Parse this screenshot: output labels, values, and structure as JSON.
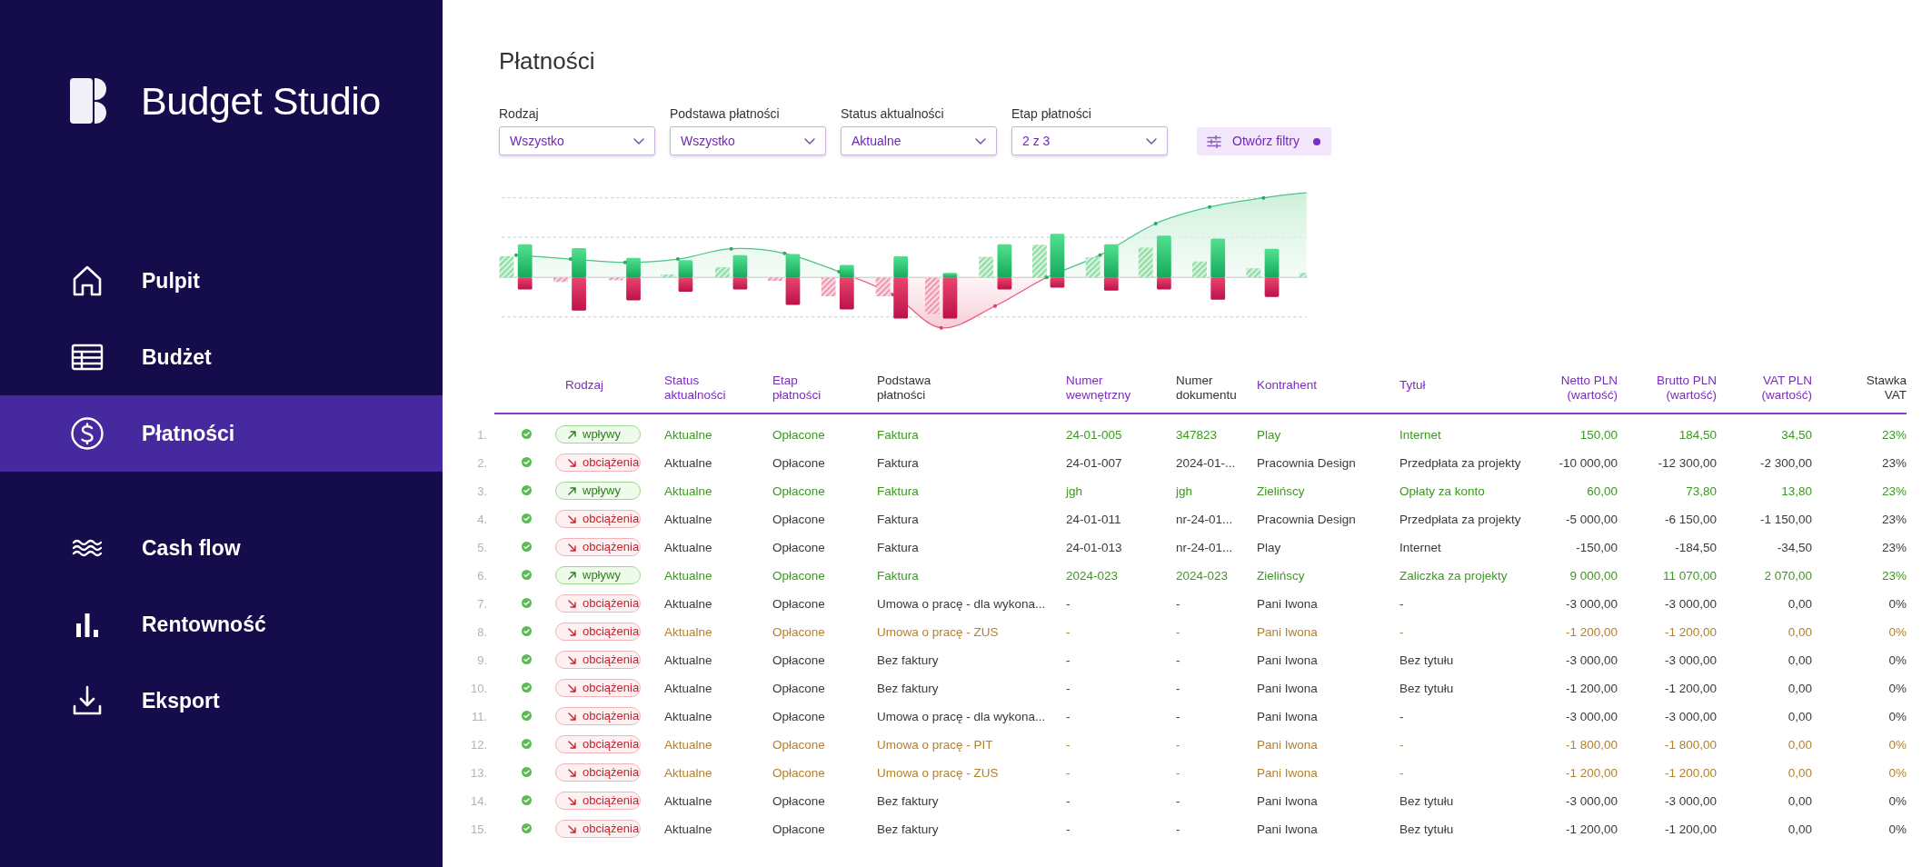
{
  "sidebar": {
    "app_name": "Budget Studio",
    "nav_groups": [
      {
        "items": [
          {
            "label": "Pulpit",
            "selected": false
          },
          {
            "label": "Budżet",
            "selected": false
          },
          {
            "label": "Płatności",
            "selected": true
          }
        ]
      },
      {
        "items": [
          {
            "label": "Cash flow",
            "selected": false
          },
          {
            "label": "Rentowność",
            "selected": false
          },
          {
            "label": "Eksport",
            "selected": false
          }
        ]
      }
    ]
  },
  "page": {
    "title": "Płatności"
  },
  "filters": [
    {
      "label": "Rodzaj",
      "value": "Wszystko"
    },
    {
      "label": "Podstawa płatności",
      "value": "Wszystko"
    },
    {
      "label": "Status aktualności",
      "value": "Aktualne"
    },
    {
      "label": "Etap płatności",
      "value": "2 z 3"
    }
  ],
  "filter_button": {
    "label": "Otwórz filtry",
    "indicator": true
  },
  "table": {
    "columns": [
      {
        "label": "Rodzaj",
        "kind": "tag",
        "highlighted": true
      },
      {
        "label": "Status\naktualności",
        "kind": "text",
        "highlighted": true
      },
      {
        "label": "Etap\npłatności",
        "kind": "text",
        "highlighted": true
      },
      {
        "label": "Podstawa\npłatności",
        "kind": "text",
        "highlighted": false
      },
      {
        "label": "Numer\nwewnętrzny",
        "kind": "text",
        "highlighted": true
      },
      {
        "label": "Numer\ndokumentu",
        "kind": "text",
        "highlighted": false
      },
      {
        "label": "Kontrahent",
        "kind": "text",
        "highlighted": true
      },
      {
        "label": "Tytuł",
        "kind": "text",
        "highlighted": true
      },
      {
        "label": "Netto PLN\n(wartość)",
        "kind": "amount",
        "highlighted": true
      },
      {
        "label": "Brutto PLN\n(wartość)",
        "kind": "amount",
        "highlighted": true
      },
      {
        "label": "VAT PLN\n(wartość)",
        "kind": "amount",
        "highlighted": true
      },
      {
        "label": "Stawka\nVAT",
        "kind": "amount",
        "highlighted": false
      }
    ],
    "rows": [
      {
        "number": "1.",
        "confirmed": true,
        "kind": "inflow",
        "color": "#3a9a1e",
        "cells": [
          "wpływy",
          "Aktualne",
          "Opłacone",
          "Faktura",
          "24-01-005",
          "347823",
          "Play",
          "Internet",
          "150,00",
          "184,50",
          "34,50",
          "23%"
        ]
      },
      {
        "number": "2.",
        "confirmed": true,
        "kind": "outflow",
        "color": "#3a3a3a",
        "cells": [
          "obciążenia",
          "Aktualne",
          "Opłacone",
          "Faktura",
          "24-01-007",
          "2024-01-...",
          "Pracownia Design",
          "Przedpłata za projekty",
          "-10 000,00",
          "-12 300,00",
          "-2 300,00",
          "23%"
        ]
      },
      {
        "number": "3.",
        "confirmed": true,
        "kind": "inflow",
        "color": "#3a9a1e",
        "cells": [
          "wpływy",
          "Aktualne",
          "Opłacone",
          "Faktura",
          "jgh",
          "jgh",
          "Zielińscy",
          "Opłaty za konto",
          "60,00",
          "73,80",
          "13,80",
          "23%"
        ]
      },
      {
        "number": "4.",
        "confirmed": true,
        "kind": "outflow",
        "color": "#3a3a3a",
        "cells": [
          "obciążenia",
          "Aktualne",
          "Opłacone",
          "Faktura",
          "24-01-011",
          "nr-24-01...",
          "Pracownia Design",
          "Przedpłata za projekty",
          "-5 000,00",
          "-6 150,00",
          "-1 150,00",
          "23%"
        ]
      },
      {
        "number": "5.",
        "confirmed": true,
        "kind": "outflow",
        "color": "#3a3a3a",
        "cells": [
          "obciążenia",
          "Aktualne",
          "Opłacone",
          "Faktura",
          "24-01-013",
          "nr-24-01...",
          "Play",
          "Internet",
          "-150,00",
          "-184,50",
          "-34,50",
          "23%"
        ]
      },
      {
        "number": "6.",
        "confirmed": true,
        "kind": "inflow",
        "color": "#3a9a1e",
        "cells": [
          "wpływy",
          "Aktualne",
          "Opłacone",
          "Faktura",
          "2024-023",
          "2024-023",
          "Zielińscy",
          "Zaliczka za projekty",
          "9 000,00",
          "11 070,00",
          "2 070,00",
          "23%"
        ]
      },
      {
        "number": "7.",
        "confirmed": true,
        "kind": "outflow",
        "color": "#3a3a3a",
        "cells": [
          "obciążenia",
          "Aktualne",
          "Opłacone",
          "Umowa o pracę - dla wykona...",
          "-",
          "-",
          "Pani Iwona",
          "-",
          "-3 000,00",
          "-3 000,00",
          "0,00",
          "0%"
        ]
      },
      {
        "number": "8.",
        "confirmed": true,
        "kind": "outflow",
        "color": "#b5812a",
        "cells": [
          "obciążenia",
          "Aktualne",
          "Opłacone",
          "Umowa o pracę - ZUS",
          "-",
          "-",
          "Pani Iwona",
          "-",
          "-1 200,00",
          "-1 200,00",
          "0,00",
          "0%"
        ]
      },
      {
        "number": "9.",
        "confirmed": true,
        "kind": "outflow",
        "color": "#3a3a3a",
        "cells": [
          "obciążenia",
          "Aktualne",
          "Opłacone",
          "Bez faktury",
          "-",
          "-",
          "Pani Iwona",
          "Bez tytułu",
          "-3 000,00",
          "-3 000,00",
          "0,00",
          "0%"
        ]
      },
      {
        "number": "10.",
        "confirmed": true,
        "kind": "outflow",
        "color": "#3a3a3a",
        "cells": [
          "obciążenia",
          "Aktualne",
          "Opłacone",
          "Bez faktury",
          "-",
          "-",
          "Pani Iwona",
          "Bez tytułu",
          "-1 200,00",
          "-1 200,00",
          "0,00",
          "0%"
        ]
      },
      {
        "number": "11.",
        "confirmed": true,
        "kind": "outflow",
        "color": "#3a3a3a",
        "cells": [
          "obciążenia",
          "Aktualne",
          "Opłacone",
          "Umowa o pracę - dla wykona...",
          "-",
          "-",
          "Pani Iwona",
          "-",
          "-3 000,00",
          "-3 000,00",
          "0,00",
          "0%"
        ]
      },
      {
        "number": "12.",
        "confirmed": true,
        "kind": "outflow",
        "color": "#b5812a",
        "cells": [
          "obciążenia",
          "Aktualne",
          "Opłacone",
          "Umowa o pracę - PIT",
          "-",
          "-",
          "Pani Iwona",
          "-",
          "-1 800,00",
          "-1 800,00",
          "0,00",
          "0%"
        ]
      },
      {
        "number": "13.",
        "confirmed": true,
        "kind": "outflow",
        "color": "#b5812a",
        "cells": [
          "obciążenia",
          "Aktualne",
          "Opłacone",
          "Umowa o pracę - ZUS",
          "-",
          "-",
          "Pani Iwona",
          "-",
          "-1 200,00",
          "-1 200,00",
          "0,00",
          "0%"
        ]
      },
      {
        "number": "14.",
        "confirmed": true,
        "kind": "outflow",
        "color": "#3a3a3a",
        "cells": [
          "obciążenia",
          "Aktualne",
          "Opłacone",
          "Bez faktury",
          "-",
          "-",
          "Pani Iwona",
          "Bez tytułu",
          "-3 000,00",
          "-3 000,00",
          "0,00",
          "0%"
        ]
      },
      {
        "number": "15.",
        "confirmed": true,
        "kind": "outflow",
        "color": "#3a3a3a",
        "cells": [
          "obciążenia",
          "Aktualne",
          "Opłacone",
          "Bez faktury",
          "-",
          "-",
          "Pani Iwona",
          "Bez tytułu",
          "-1 200,00",
          "-1 200,00",
          "0,00",
          "0%"
        ]
      }
    ]
  }
}
